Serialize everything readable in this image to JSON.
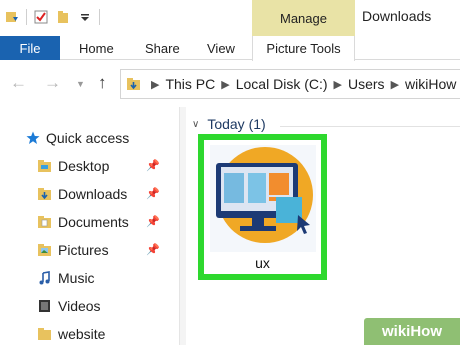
{
  "window": {
    "title": "Downloads",
    "context_tab": "Manage"
  },
  "ribbon": {
    "file": "File",
    "tabs": [
      "Home",
      "Share",
      "View"
    ],
    "context_group": "Picture Tools"
  },
  "address": {
    "crumbs": [
      "This PC",
      "Local Disk (C:)",
      "Users",
      "wikiHow"
    ]
  },
  "sidebar": {
    "quick_access": "Quick access",
    "items": [
      {
        "label": "Desktop",
        "pinned": true
      },
      {
        "label": "Downloads",
        "pinned": true
      },
      {
        "label": "Documents",
        "pinned": true
      },
      {
        "label": "Pictures",
        "pinned": true
      },
      {
        "label": "Music",
        "pinned": false
      },
      {
        "label": "Videos",
        "pinned": false
      },
      {
        "label": "website",
        "pinned": false
      }
    ]
  },
  "content": {
    "group_label": "Today (1)",
    "file": {
      "name": "ux",
      "selected": true
    }
  },
  "watermark": "wikiHow",
  "colors": {
    "file_tab": "#1a63b0",
    "manage_tab": "#e9e3a6",
    "highlight": "#2ed82e"
  }
}
